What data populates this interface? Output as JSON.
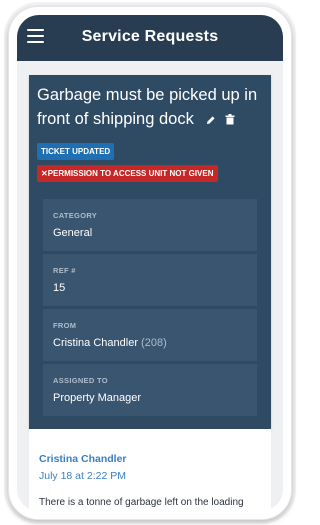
{
  "app": {
    "title": "Service Requests"
  },
  "ticket": {
    "title": "Garbage must be picked up in front of shipping dock",
    "badges": {
      "updated": "TICKET UPDATED",
      "permission": "PERMISSION TO ACCESS UNIT NOT GIVEN"
    },
    "fields": {
      "category": {
        "label": "CATEGORY",
        "value": "General"
      },
      "ref": {
        "label": "REF #",
        "value": "15"
      },
      "from": {
        "label": "FROM",
        "name": "Cristina Chandler",
        "unit": "(208)"
      },
      "assigned": {
        "label": "ASSIGNED TO",
        "value": "Property Manager"
      }
    }
  },
  "comment": {
    "author": "Cristina Chandler",
    "date": "July 18 at 2:22 PM",
    "body": "There is a tonne of garbage left on the loading dock next to the parking area"
  },
  "icons": {
    "menu": "hamburger-menu-icon",
    "edit": "pencil-icon",
    "delete": "trash-icon",
    "x": "close-x-icon"
  },
  "colors": {
    "appbar": "#293d52",
    "card": "#2f4a63",
    "field": "#3a5570",
    "badge_updated": "#1f6fb2",
    "badge_permission": "#c62828",
    "link": "#3a7fc1"
  }
}
